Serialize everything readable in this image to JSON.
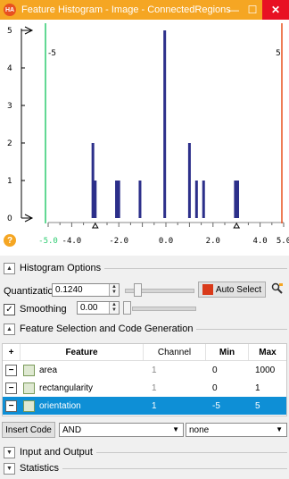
{
  "window": {
    "title": "Feature Histogram - Image - ConnectedRegions",
    "app_icon_text": "HA",
    "minimize_glyph": "—",
    "maximize_glyph": "☐",
    "close_glyph": "✕"
  },
  "chart_data": {
    "type": "bar",
    "xlim": [
      -5.0,
      5.0
    ],
    "ylim": [
      0,
      5
    ],
    "x_ticks": [
      "-5.0",
      "-4.0",
      "-2.0",
      "0.0",
      "2.0",
      "4.0",
      "5.0"
    ],
    "y_ticks": [
      "0",
      "1",
      "2",
      "3",
      "4",
      "5"
    ],
    "bars": [
      {
        "x": -3.1,
        "y": 2
      },
      {
        "x": -3.0,
        "y": 1
      },
      {
        "x": -2.1,
        "y": 1
      },
      {
        "x": -2.0,
        "y": 1
      },
      {
        "x": -1.1,
        "y": 1
      },
      {
        "x": -0.05,
        "y": 5
      },
      {
        "x": 1.0,
        "y": 2
      },
      {
        "x": 1.3,
        "y": 1
      },
      {
        "x": 1.6,
        "y": 1
      },
      {
        "x": 2.95,
        "y": 1
      },
      {
        "x": 3.05,
        "y": 1
      }
    ],
    "min_threshold": {
      "value": -5,
      "label": "-5",
      "color": "#2ecc71"
    },
    "max_threshold": {
      "value": 5,
      "label": "5",
      "color": "#e8501f"
    },
    "bar_color": "#2c2f8a",
    "markers": [
      -3.0,
      3.0
    ]
  },
  "histogram_options": {
    "title": "Histogram Options",
    "quantization_label": "Quantization",
    "quantization_value": "0.1240",
    "auto_select_label": "Auto Select",
    "smoothing_label": "Smoothing",
    "smoothing_value": "0.00",
    "smoothing_checked": true
  },
  "feature_section": {
    "title": "Feature Selection and Code Generation",
    "columns": [
      "+",
      "Feature",
      "Channel",
      "Min",
      "Max"
    ],
    "rows": [
      {
        "feature": "area",
        "channel": "1",
        "min": "0",
        "max": "1000",
        "selected": false
      },
      {
        "feature": "rectangularity",
        "channel": "1",
        "min": "0",
        "max": "1",
        "selected": false
      },
      {
        "feature": "orientation",
        "channel": "1",
        "min": "-5",
        "max": "5",
        "selected": true
      }
    ],
    "insert_code_label": "Insert Code",
    "operator_value": "AND",
    "mode_value": "none"
  },
  "collapsed_sections": {
    "input_output": "Input and Output",
    "statistics": "Statistics"
  }
}
